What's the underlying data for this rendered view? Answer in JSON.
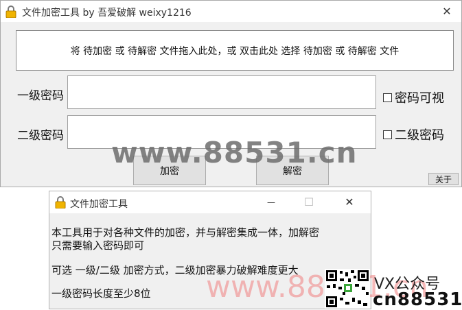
{
  "main_window": {
    "title": "文件加密工具 by 吾爱破解 weixy1216",
    "close_glyph": "✕",
    "drop_zone_text": "将 待加密 或 待解密 文件拖入此处，或 双击此处 选择 待加密 或 待解密 文件",
    "level1_label": "一级密码",
    "level1_value": "",
    "level2_label": "二级密码",
    "level2_value": "",
    "show_password_label": "密码可视",
    "level2_checkbox_label": "二级密码",
    "encrypt_button": "加密",
    "decrypt_button": "解密",
    "about_button": "关于"
  },
  "about_window": {
    "title": "文件加密工具",
    "minimize_glyph": "—",
    "maximize_glyph": "☐",
    "close_glyph": "✕",
    "line1a": "本工具用于对各种文件的加密，并与解密集成一体，加解密",
    "line1b": "只需要输入密码即可",
    "line2": "可选 一级/二级 加密方式，二级加密暴力破解难度更大",
    "line3": "一级密码长度至少8位"
  },
  "watermark": {
    "site_center": "www.88531.cn",
    "site_bottom": "www.88531.cn",
    "vx_label": "VX公众号",
    "vx_id": "cn88531"
  },
  "colors": {
    "window_bg": "#f0f0f0",
    "titlebar_bg": "#ffffff",
    "lock_body": "#f0b400",
    "watermark_gray": "#6e6e6e",
    "watermark_red": "#f08080"
  }
}
